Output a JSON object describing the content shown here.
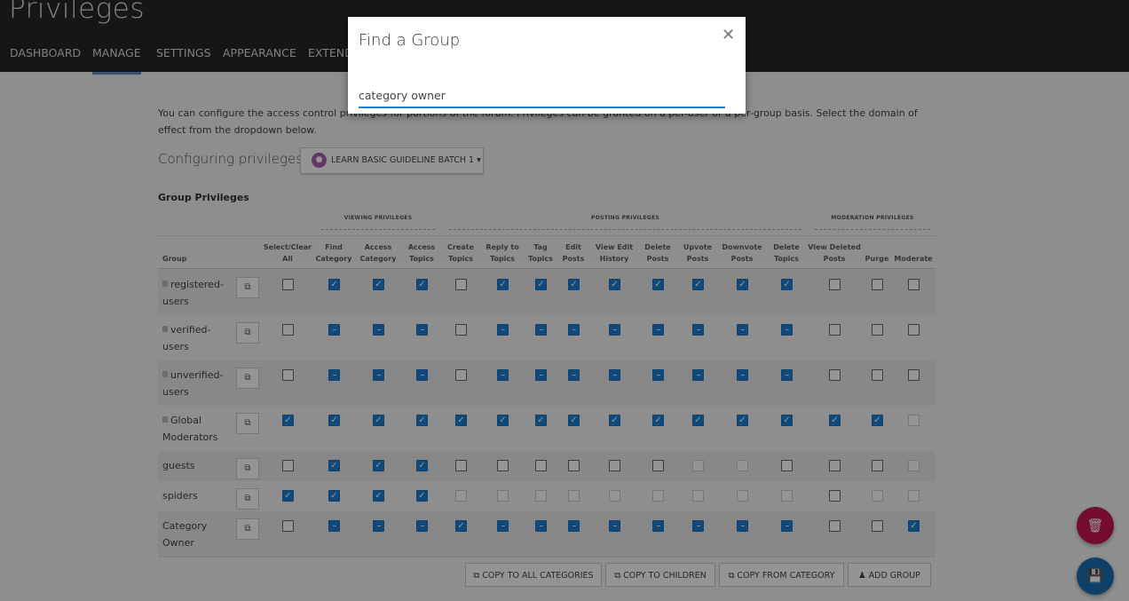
{
  "page": {
    "title": "Privileges"
  },
  "nav": {
    "items": [
      "DASHBOARD",
      "MANAGE",
      "SETTINGS",
      "APPEARANCE",
      "EXTEND"
    ],
    "active": "MANAGE"
  },
  "intro": {
    "text": "You can configure the access control privileges for portions of the forum. Privileges can be granted on a per-user or a per-group basis. Select the domain of effect from the dropdown below."
  },
  "config": {
    "label": "Configuring privileges for",
    "category": "LEARN BASIC GUIDELINE BATCH 1"
  },
  "section": {
    "title": "Group Privileges"
  },
  "groups": {
    "viewing": "VIEWING PRIVILEGES",
    "posting": "POSTING PRIVILEGES",
    "moderation": "MODERATION PRIVILEGES"
  },
  "columns": {
    "group": "Group",
    "select_all": [
      "Select/Clear",
      "All"
    ],
    "find_category": [
      "Find",
      "Category"
    ],
    "access_category": [
      "Access",
      "Category"
    ],
    "access_topics": [
      "Access",
      "Topics"
    ],
    "create_topics": [
      "Create",
      "Topics"
    ],
    "reply_topics": [
      "Reply to",
      "Topics"
    ],
    "tag_topics": [
      "Tag",
      "Topics"
    ],
    "edit_posts": [
      "Edit",
      "Posts"
    ],
    "view_edit_history": [
      "View Edit",
      "History"
    ],
    "delete_posts": [
      "Delete",
      "Posts"
    ],
    "upvote_posts": [
      "Upvote",
      "Posts"
    ],
    "downvote_posts": [
      "Downvote",
      "Posts"
    ],
    "delete_topics": [
      "Delete",
      "Topics"
    ],
    "view_deleted_posts": [
      "View Deleted",
      "Posts"
    ],
    "purge": [
      "",
      "Purge"
    ],
    "moderate": [
      "",
      "Moderate"
    ]
  },
  "rows": [
    {
      "name": [
        "registered-",
        "users"
      ],
      "locked": true,
      "states": [
        "off",
        "on",
        "on",
        "on",
        "off",
        "on",
        "on",
        "on",
        "on",
        "on",
        "on",
        "on",
        "on",
        "off",
        "off",
        "off"
      ]
    },
    {
      "name": [
        "verified-",
        "users"
      ],
      "locked": true,
      "states": [
        "off",
        "ind",
        "ind",
        "ind",
        "off",
        "ind",
        "ind",
        "ind",
        "ind",
        "ind",
        "ind",
        "ind",
        "ind",
        "off",
        "off",
        "off"
      ]
    },
    {
      "name": [
        "unverified-",
        "users"
      ],
      "locked": true,
      "states": [
        "off",
        "ind",
        "ind",
        "ind",
        "off",
        "ind",
        "ind",
        "ind",
        "ind",
        "ind",
        "ind",
        "ind",
        "ind",
        "off",
        "off",
        "off"
      ]
    },
    {
      "name": [
        "Global",
        "Moderators"
      ],
      "locked": true,
      "states": [
        "on",
        "on",
        "on",
        "on",
        "on",
        "on",
        "on",
        "on",
        "on",
        "on",
        "on",
        "on",
        "on",
        "on",
        "on",
        "dis"
      ]
    },
    {
      "name": [
        "guests",
        ""
      ],
      "locked": false,
      "states": [
        "off",
        "on",
        "on",
        "on",
        "off",
        "off",
        "off",
        "off",
        "off",
        "off",
        "dis",
        "dis",
        "off",
        "off",
        "off",
        "dis"
      ]
    },
    {
      "name": [
        "spiders",
        ""
      ],
      "locked": false,
      "states": [
        "on",
        "on",
        "on",
        "on",
        "dis",
        "dis",
        "dis",
        "dis",
        "dis",
        "dis",
        "dis",
        "dis",
        "dis",
        "off",
        "dis",
        "dis"
      ]
    },
    {
      "name": [
        "Category",
        "Owner"
      ],
      "locked": false,
      "states": [
        "off",
        "ind",
        "ind",
        "ind",
        "on",
        "ind",
        "ind",
        "ind",
        "ind",
        "ind",
        "ind",
        "ind",
        "ind",
        "off",
        "off",
        "on"
      ]
    }
  ],
  "footer": {
    "copy_all": "COPY TO ALL CATEGORIES",
    "copy_children": "COPY TO CHILDREN",
    "copy_from": "COPY FROM CATEGORY",
    "add_group": "ADD GROUP"
  },
  "icons": {
    "copy": "copy-icon",
    "trash": "trash-icon",
    "save": "save-icon",
    "users": "users-icon",
    "close": "close-icon",
    "lock": "lock-icon"
  },
  "colors": {
    "accent": "#1e7fd4",
    "delete_fab": "#c9174f",
    "save_fab": "#1b6fb5"
  },
  "modal": {
    "title": "Find a Group",
    "input_value": "category owner"
  }
}
